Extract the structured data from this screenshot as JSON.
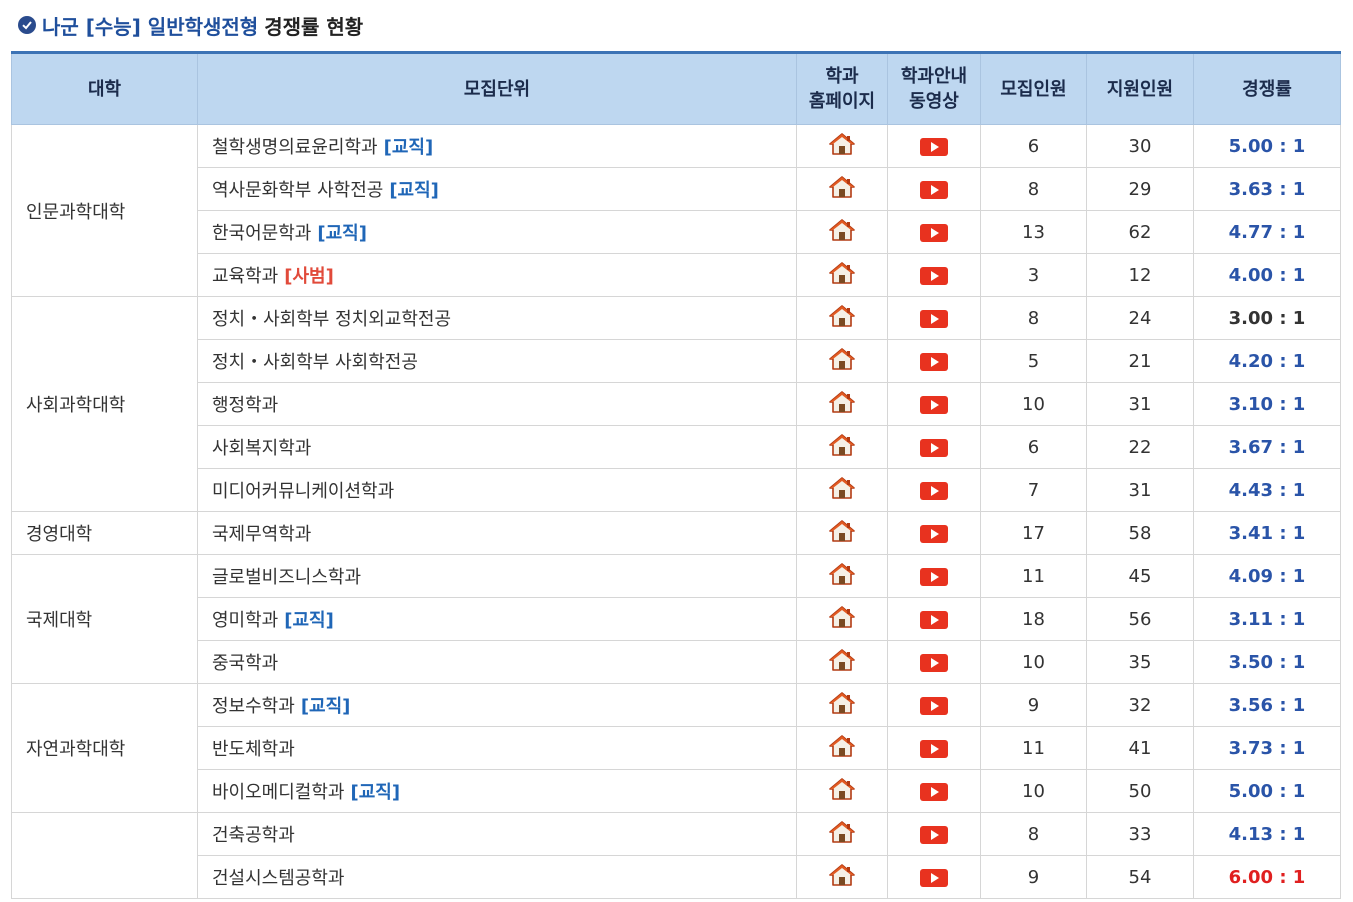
{
  "header": {
    "title_highlight": "나군 [수능] 일반학생전형",
    "title_rest": "경쟁률 현황"
  },
  "columns": {
    "univ": "대학",
    "dept": "모집단위",
    "home_line1": "학과",
    "home_line2": "홈페이지",
    "video_line1": "학과안내",
    "video_line2": "동영상",
    "quota": "모집인원",
    "applicants": "지원인원",
    "rate": "경쟁률"
  },
  "icons": {
    "home": "house-icon",
    "video": "play-video-icon"
  },
  "colors": {
    "header_bg": "#bed7f0",
    "header_top_border": "#3c73b5",
    "tag_blue": "#1f66b7",
    "tag_red": "#e14a3a",
    "rate_blue": "#2a54a8",
    "rate_red": "#e02020"
  },
  "groups": [
    {
      "univ": "인문과학대학",
      "rows": [
        {
          "dept": "철학생명의료윤리학과",
          "tag": "[교직]",
          "tag_color": "blue",
          "quota": "6",
          "applicants": "30",
          "rate": "5.00 : 1",
          "rate_color": "blue"
        },
        {
          "dept": "역사문화학부 사학전공",
          "tag": "[교직]",
          "tag_color": "blue",
          "quota": "8",
          "applicants": "29",
          "rate": "3.63 : 1",
          "rate_color": "blue"
        },
        {
          "dept": "한국어문학과",
          "tag": "[교직]",
          "tag_color": "blue",
          "quota": "13",
          "applicants": "62",
          "rate": "4.77 : 1",
          "rate_color": "blue"
        },
        {
          "dept": "교육학과",
          "tag": "[사범]",
          "tag_color": "red",
          "quota": "3",
          "applicants": "12",
          "rate": "4.00 : 1",
          "rate_color": "blue"
        }
      ]
    },
    {
      "univ": "사회과학대학",
      "rows": [
        {
          "dept": "정치・사회학부 정치외교학전공",
          "tag": "",
          "tag_color": "",
          "quota": "8",
          "applicants": "24",
          "rate": "3.00 : 1",
          "rate_color": "dark"
        },
        {
          "dept": "정치・사회학부 사회학전공",
          "tag": "",
          "tag_color": "",
          "quota": "5",
          "applicants": "21",
          "rate": "4.20 : 1",
          "rate_color": "blue"
        },
        {
          "dept": "행정학과",
          "tag": "",
          "tag_color": "",
          "quota": "10",
          "applicants": "31",
          "rate": "3.10 : 1",
          "rate_color": "blue"
        },
        {
          "dept": "사회복지학과",
          "tag": "",
          "tag_color": "",
          "quota": "6",
          "applicants": "22",
          "rate": "3.67 : 1",
          "rate_color": "blue"
        },
        {
          "dept": "미디어커뮤니케이션학과",
          "tag": "",
          "tag_color": "",
          "quota": "7",
          "applicants": "31",
          "rate": "4.43 : 1",
          "rate_color": "blue"
        }
      ]
    },
    {
      "univ": "경영대학",
      "rows": [
        {
          "dept": "국제무역학과",
          "tag": "",
          "tag_color": "",
          "quota": "17",
          "applicants": "58",
          "rate": "3.41 : 1",
          "rate_color": "blue"
        }
      ]
    },
    {
      "univ": "국제대학",
      "rows": [
        {
          "dept": "글로벌비즈니스학과",
          "tag": "",
          "tag_color": "",
          "quota": "11",
          "applicants": "45",
          "rate": "4.09 : 1",
          "rate_color": "blue"
        },
        {
          "dept": "영미학과",
          "tag": "[교직]",
          "tag_color": "blue",
          "quota": "18",
          "applicants": "56",
          "rate": "3.11 : 1",
          "rate_color": "blue"
        },
        {
          "dept": "중국학과",
          "tag": "",
          "tag_color": "",
          "quota": "10",
          "applicants": "35",
          "rate": "3.50 : 1",
          "rate_color": "blue"
        }
      ]
    },
    {
      "univ": "자연과학대학",
      "rows": [
        {
          "dept": "정보수학과",
          "tag": "[교직]",
          "tag_color": "blue",
          "quota": "9",
          "applicants": "32",
          "rate": "3.56 : 1",
          "rate_color": "blue"
        },
        {
          "dept": "반도체학과",
          "tag": "",
          "tag_color": "",
          "quota": "11",
          "applicants": "41",
          "rate": "3.73 : 1",
          "rate_color": "blue"
        },
        {
          "dept": "바이오메디컬학과",
          "tag": "[교직]",
          "tag_color": "blue",
          "quota": "10",
          "applicants": "50",
          "rate": "5.00 : 1",
          "rate_color": "blue"
        }
      ]
    },
    {
      "univ": "",
      "rows": [
        {
          "dept": "건축공학과",
          "tag": "",
          "tag_color": "",
          "quota": "8",
          "applicants": "33",
          "rate": "4.13 : 1",
          "rate_color": "blue"
        },
        {
          "dept": "건설시스템공학과",
          "tag": "",
          "tag_color": "",
          "quota": "9",
          "applicants": "54",
          "rate": "6.00 : 1",
          "rate_color": "red"
        }
      ]
    }
  ]
}
